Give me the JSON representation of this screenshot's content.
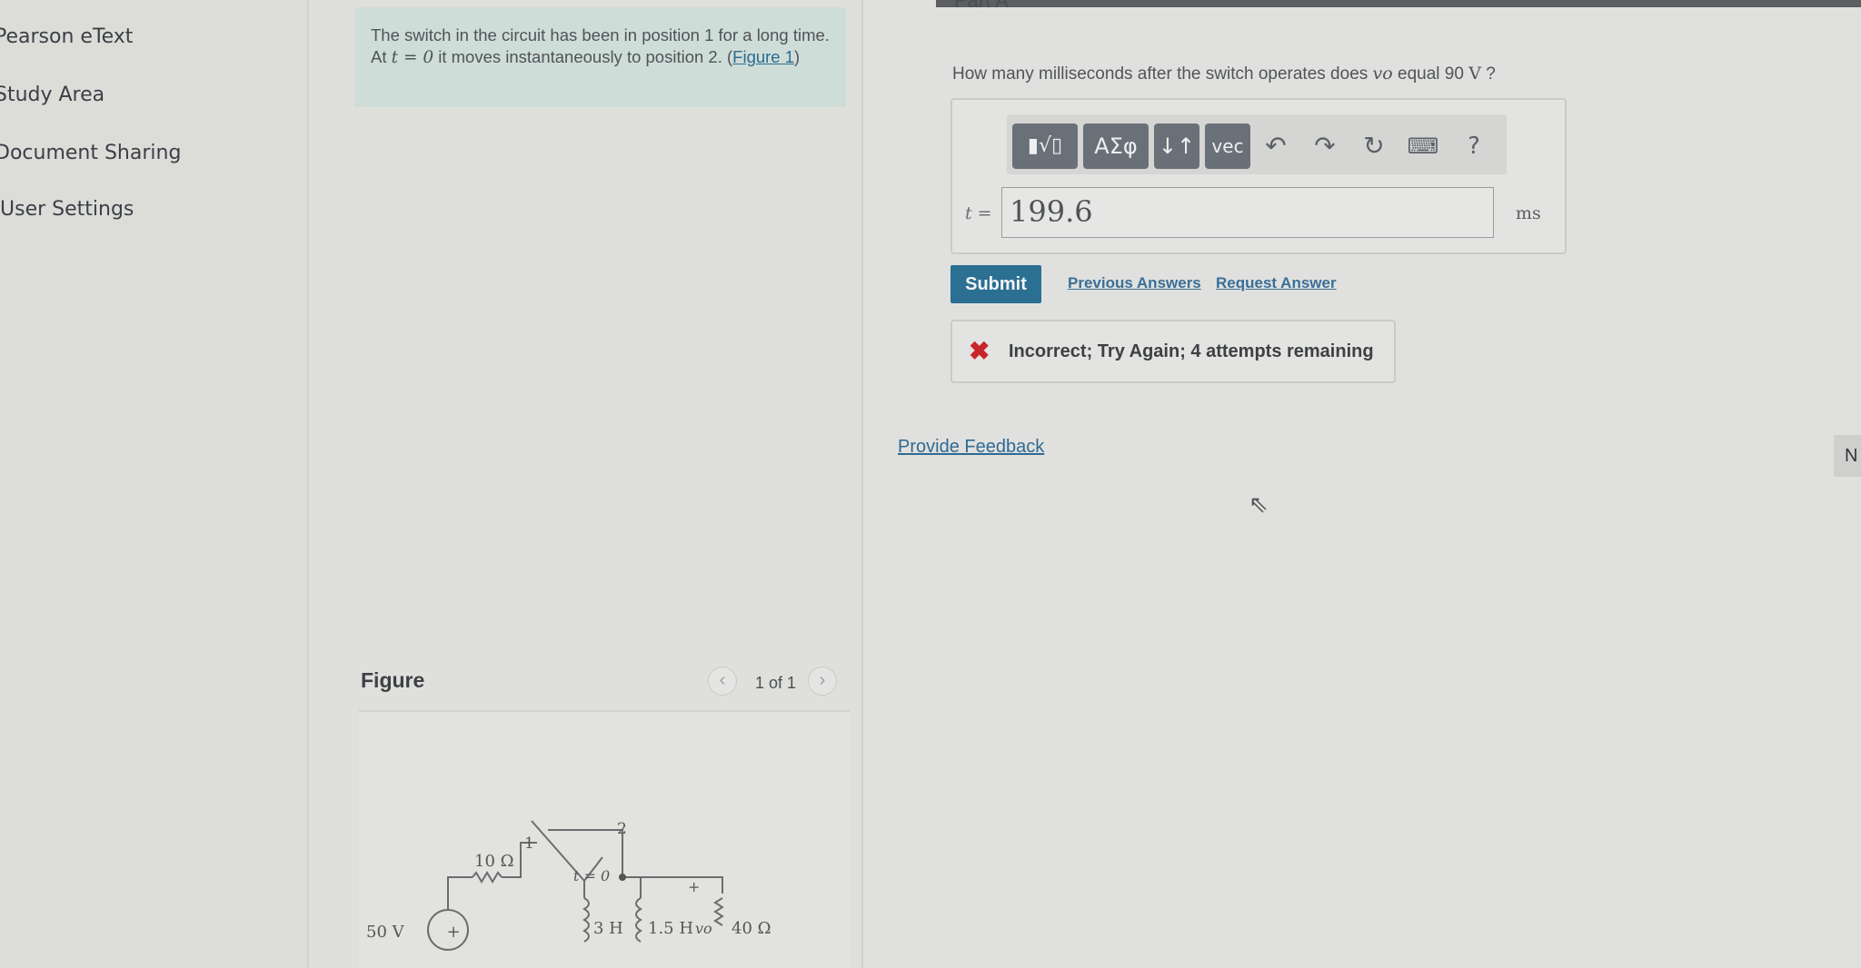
{
  "sidebar": {
    "items": [
      {
        "label": "Pearson eText"
      },
      {
        "label": "Study Area"
      },
      {
        "label": "Document Sharing"
      },
      {
        "label": "User Settings"
      }
    ]
  },
  "problem": {
    "intro_part1": "The switch in the circuit has been in position 1 for a long time. At ",
    "intro_math": "t = 0",
    "intro_part2": " it moves instantaneously to position 2. (",
    "figure_link": "Figure 1",
    "intro_close": ")"
  },
  "figure": {
    "title": "Figure",
    "pager": "1 of 1",
    "prev_icon": "chevron-left-icon",
    "next_icon": "chevron-right-icon",
    "labels": {
      "source": "50 V",
      "r1": "10 Ω",
      "pos1": "1",
      "pos2": "2",
      "switch_time": "t = 0",
      "l1": "3 H",
      "l2": "1.5 H",
      "vo": "vo",
      "r2": "40 Ω",
      "plus": "+"
    }
  },
  "part": {
    "label": "Part A",
    "question_text": "How many milliseconds after the switch operates does ",
    "question_var": "vo",
    "question_mid": " equal 90 ",
    "question_unit": "V",
    "question_end": " ?"
  },
  "toolbar": {
    "templates_icon": "templates-icon",
    "greek_label": "ΑΣφ",
    "arrows_label": "↓↑",
    "vec_label": "vec",
    "undo_icon": "undo-icon",
    "redo_icon": "redo-icon",
    "reset_icon": "reset-icon",
    "keyboard_icon": "keyboard-icon",
    "help_label": "?"
  },
  "answer": {
    "var_label": "t =",
    "value": "199.6",
    "unit": "ms"
  },
  "actions": {
    "submit": "Submit",
    "previous_answers": "Previous Answers",
    "request_answer": "Request Answer"
  },
  "feedback": {
    "icon": "x-icon",
    "message": "Incorrect; Try Again; 4 attempts remaining"
  },
  "provide_feedback": "Provide Feedback",
  "next_tab": "N",
  "colors": {
    "accent": "#2b6f93",
    "error": "#c8252c",
    "link": "#2f6a93"
  }
}
